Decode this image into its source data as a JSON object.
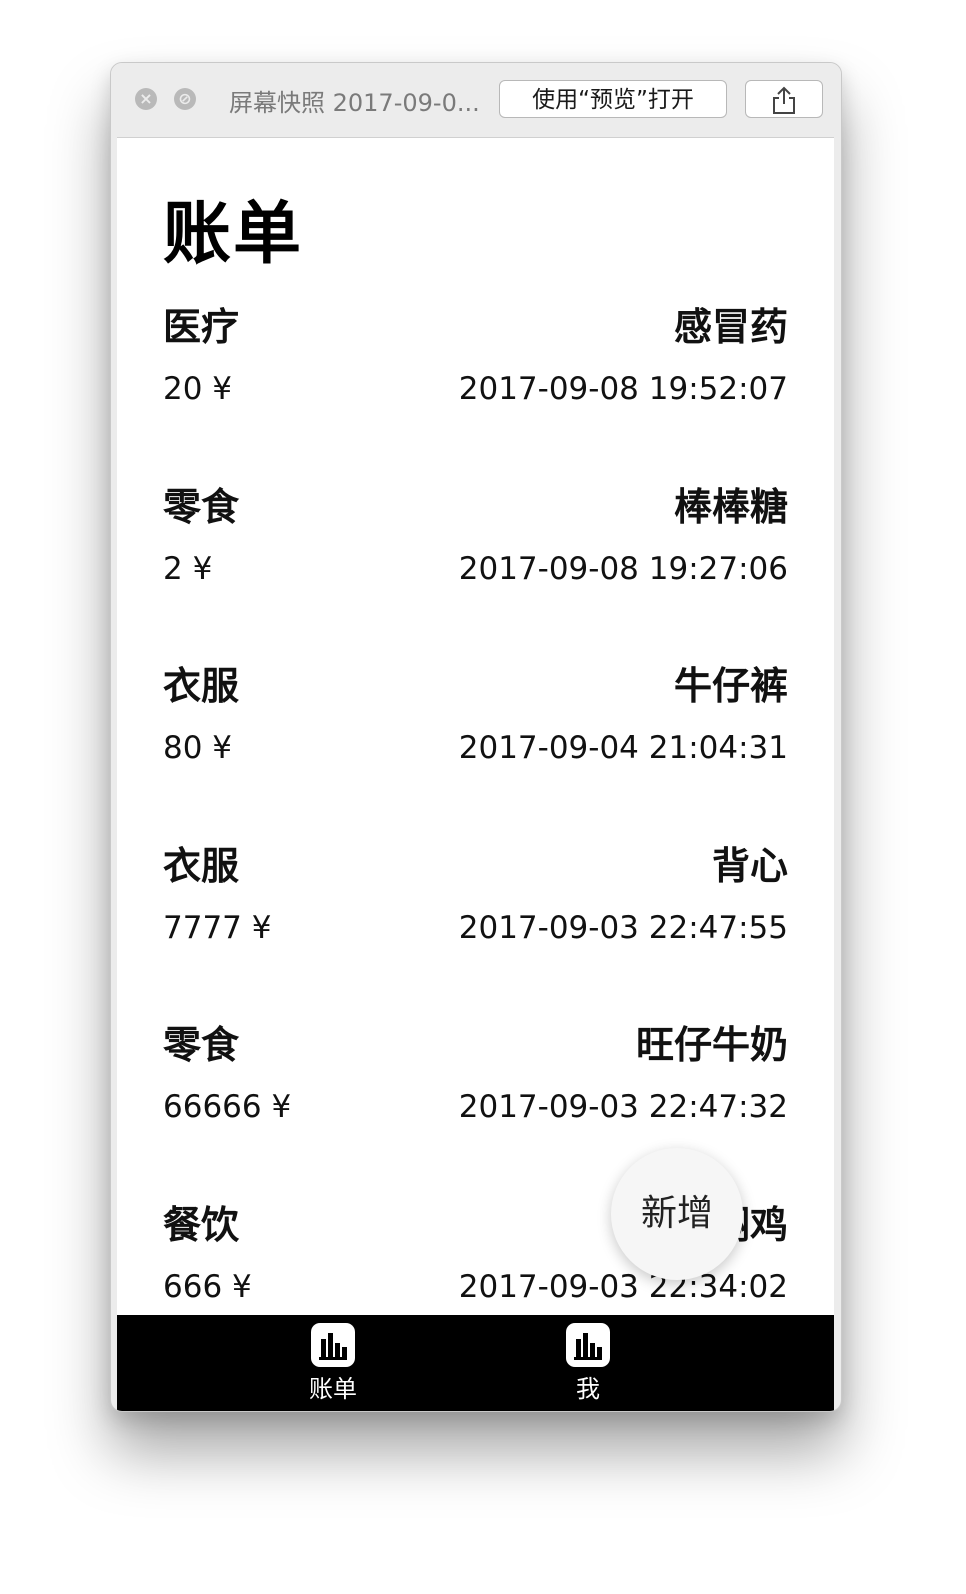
{
  "window": {
    "title": "屏幕快照 2017-09-0...",
    "open_with_preview_label": "使用“预览”打开",
    "share_icon": "share-icon"
  },
  "page": {
    "title": "账单"
  },
  "bills": [
    {
      "category": "医疗",
      "name": "感冒药",
      "amount": "20 ¥",
      "time": "2017-09-08 19:52:07"
    },
    {
      "category": "零食",
      "name": "棒棒糖",
      "amount": "2 ¥",
      "time": "2017-09-08 19:27:06"
    },
    {
      "category": "衣服",
      "name": "牛仔裤",
      "amount": "80 ¥",
      "time": "2017-09-04 21:04:31"
    },
    {
      "category": "衣服",
      "name": "背心",
      "amount": "7777 ¥",
      "time": "2017-09-03 22:47:55"
    },
    {
      "category": "零食",
      "name": "旺仔牛奶",
      "amount": "66666 ¥",
      "time": "2017-09-03 22:47:32"
    },
    {
      "category": "餐饮",
      "name": "黄焖鸡",
      "amount": "666 ¥",
      "time": "2017-09-03 22:34:02"
    }
  ],
  "fab": {
    "label": "新增"
  },
  "tabbar": {
    "tabs": [
      {
        "label": "账单",
        "icon": "bar-chart-icon"
      },
      {
        "label": "我",
        "icon": "bar-chart-icon"
      }
    ]
  }
}
